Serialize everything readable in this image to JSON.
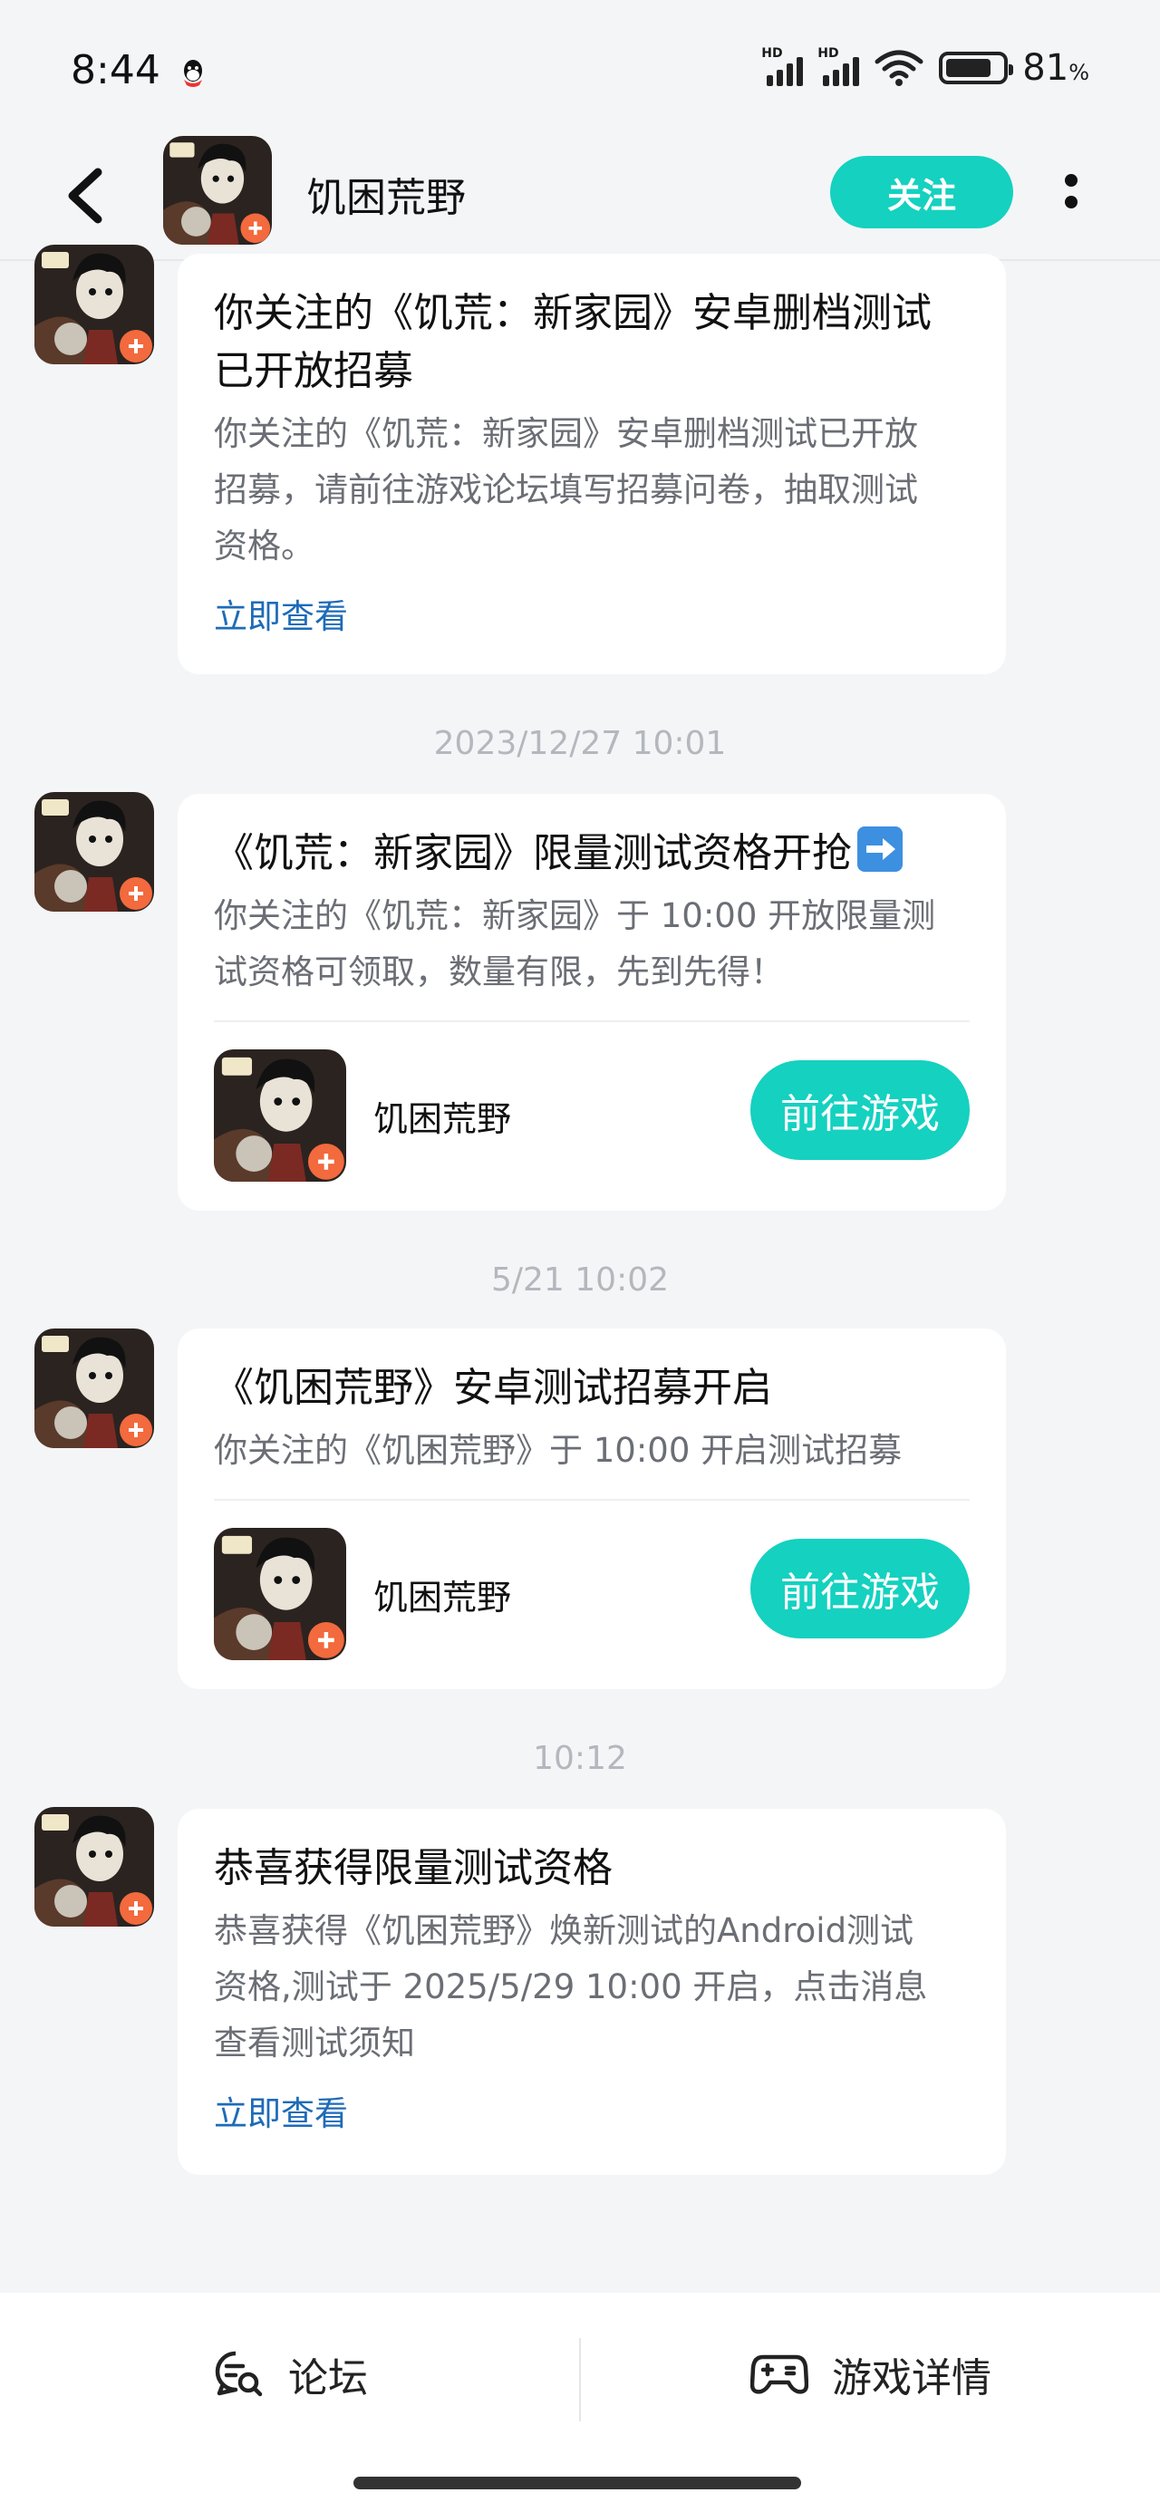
{
  "status_bar": {
    "time": "8:44",
    "battery_percent": "81",
    "battery_unit": "%",
    "signal_label_1": "HD",
    "signal_label_2": "HD",
    "icons": [
      "qq-icon",
      "signal-icon",
      "wifi-icon",
      "battery-icon"
    ]
  },
  "header": {
    "title": "饥困荒野",
    "follow_label": "关注",
    "icons": [
      "back-arrow-icon",
      "game-avatar",
      "more-dots-icon"
    ]
  },
  "messages": [
    {
      "timestamp": "",
      "title": "你关注的《饥荒：新家园》安卓删档测试已开放招募",
      "title_line1": "你关注的《饥荒：新家园》安卓删档测试",
      "title_line2": "已开放招募",
      "body_lines": [
        "你关注的《饥荒：新家园》安卓删档测试已开放",
        "招募，请前往游戏论坛填写招募问卷，抽取测试",
        "资格。"
      ],
      "link": "立即查看"
    },
    {
      "timestamp": "2023/12/27  10:01",
      "title": "《饥荒：新家园》限量测试资格开抢",
      "title_emoji": "arrow-right-emoji",
      "body_lines": [
        "你关注的《饥荒：新家园》于 10:00 开放限量测",
        "试资格可领取，数量有限，先到先得！"
      ],
      "game_name": "饥困荒野",
      "button": "前往游戏"
    },
    {
      "timestamp": "5/21  10:02",
      "title": "《饥困荒野》安卓测试招募开启",
      "body_lines": [
        "你关注的《饥困荒野》于 10:00 开启测试招募"
      ],
      "game_name": "饥困荒野",
      "button": "前往游戏"
    },
    {
      "timestamp": "10:12",
      "title": "恭喜获得限量测试资格",
      "body_lines": [
        "恭喜获得《饥困荒野》焕新测试的Android测试",
        "资格,测试于 2025/5/29 10:00 开启，点击消息",
        "查看测试须知"
      ],
      "link": "立即查看"
    }
  ],
  "bottom_bar": {
    "forum_label": "论坛",
    "details_label": "游戏详情",
    "icons": [
      "forum-search-icon",
      "gamepad-icon"
    ]
  },
  "colors": {
    "accent": "#15d1c0",
    "link": "#1e6bb8",
    "background": "#f4f5f7"
  }
}
